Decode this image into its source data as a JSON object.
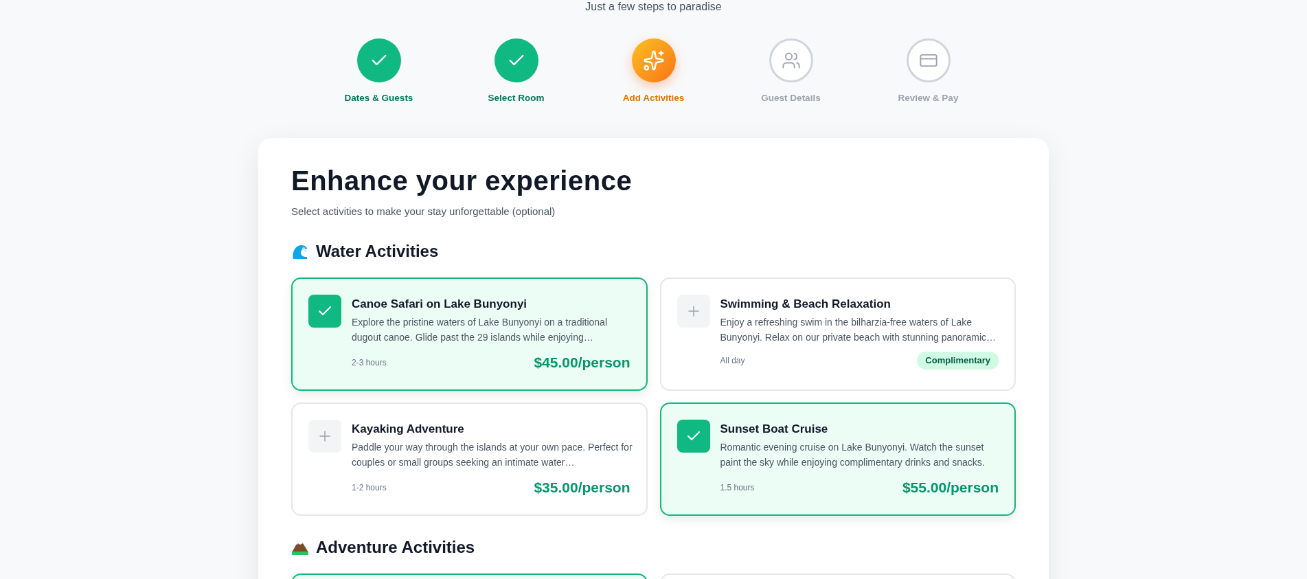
{
  "tagline": "Just a few steps to paradise",
  "steps": [
    {
      "label": "Dates & Guests",
      "kind": "done"
    },
    {
      "label": "Select Room",
      "kind": "done"
    },
    {
      "label": "Add Activities",
      "kind": "current"
    },
    {
      "label": "Guest Details",
      "kind": "upcoming"
    },
    {
      "label": "Review & Pay",
      "kind": "upcoming"
    }
  ],
  "title": "Enhance your experience",
  "subtitle": "Select activities to make your stay unforgettable (optional)",
  "sections": [
    {
      "title": "Water Activities",
      "kind": "water",
      "activities": [
        {
          "name": "Canoe Safari on Lake Bunyonyi",
          "description": "Explore the pristine waters of Lake Bunyonyi on a traditional dugout canoe. Glide past the 29 islands while enjoying…",
          "duration": "2-3 hours",
          "price": "$45.00/person",
          "selected": true
        },
        {
          "name": "Swimming & Beach Relaxation",
          "description": "Enjoy a refreshing swim in the bilharzia-free waters of Lake Bunyonyi. Relax on our private beach with stunning panoramic…",
          "duration": "All day",
          "badge": "Complimentary",
          "selected": false
        },
        {
          "name": "Kayaking Adventure",
          "description": "Paddle your way through the islands at your own pace. Perfect for couples or small groups seeking an intimate water…",
          "duration": "1-2 hours",
          "price": "$35.00/person",
          "selected": false
        },
        {
          "name": "Sunset Boat Cruise",
          "description": "Romantic evening cruise on Lake Bunyonyi. Watch the sunset paint the sky while enjoying complimentary drinks and snacks.",
          "duration": "1.5 hours",
          "price": "$55.00/person",
          "selected": true
        }
      ]
    },
    {
      "title": "Adventure Activities",
      "kind": "mountain",
      "activities": [
        {
          "selected": true
        },
        {
          "selected": false
        }
      ]
    }
  ]
}
